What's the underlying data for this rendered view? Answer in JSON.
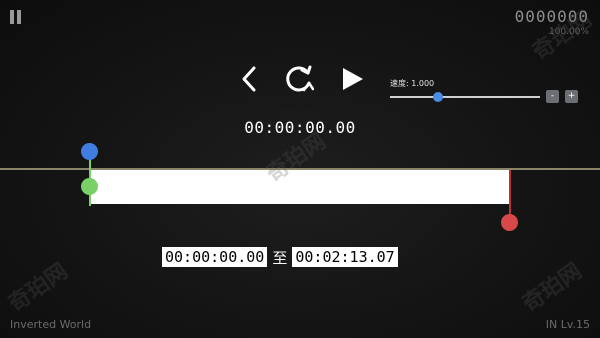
{
  "hud": {
    "score": "0000000",
    "percent": "100.00%"
  },
  "controls": {
    "prev_icon": "chevron-left-icon",
    "restart_icon": "restart-icon",
    "play_icon": "play-icon"
  },
  "speed": {
    "label": "速度: 1.000",
    "value": 1.0,
    "slider_fraction": 0.32,
    "minus": "-",
    "plus": "+"
  },
  "timeline": {
    "current_time": "00:00:00.00",
    "range_start": "00:00:00.00",
    "range_to": "至",
    "range_end": "00:02:13.07",
    "colors": {
      "start": "#7ad068",
      "handle": "#3f7ee0",
      "end": "#d84848"
    }
  },
  "footer": {
    "level_name": "Inverted World",
    "level_code": "IN Lv.15"
  },
  "watermark": "奇珀网"
}
